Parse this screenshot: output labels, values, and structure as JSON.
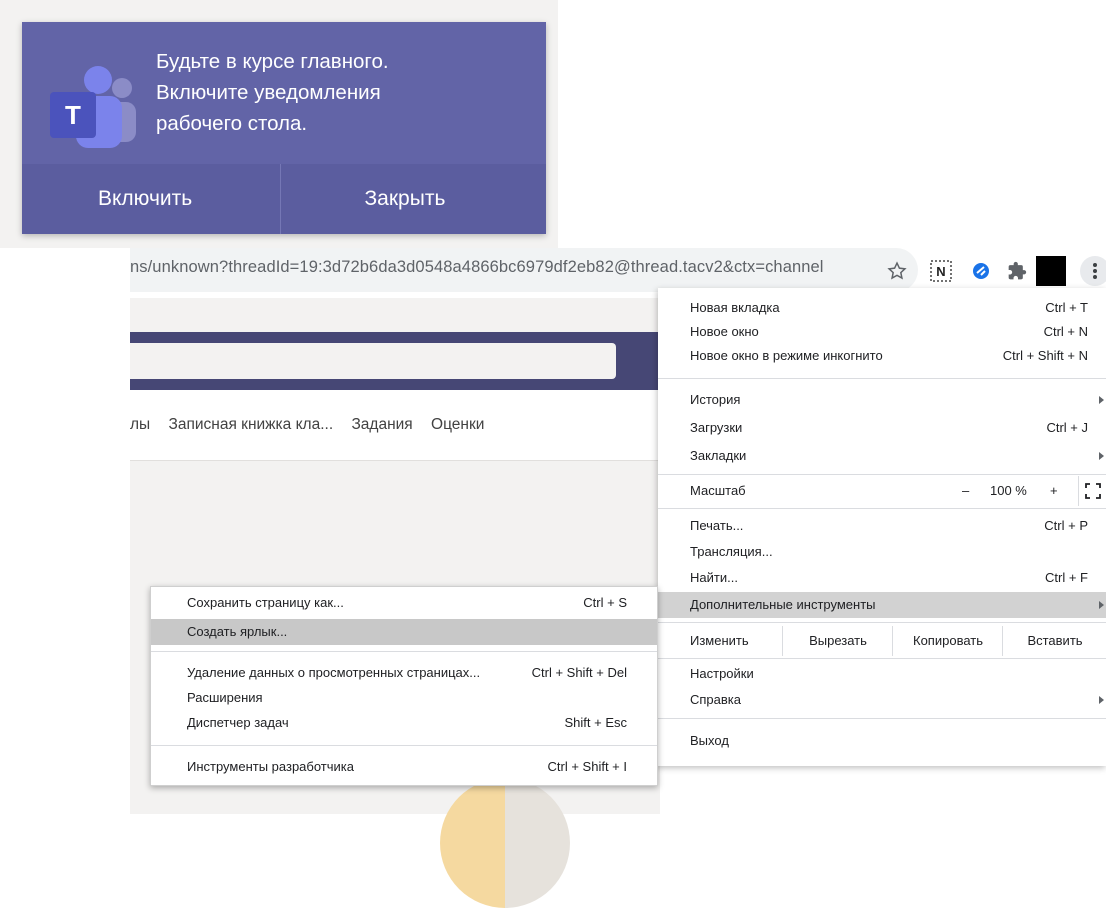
{
  "notification": {
    "lines": [
      "Будьте в курсе главного.",
      "Включите уведомления",
      "рабочего стола."
    ],
    "enable_label": "Включить",
    "close_label": "Закрыть",
    "colors": {
      "toast": "#6264a7",
      "actions": "#5b5d9f"
    }
  },
  "browser": {
    "url": "ns/unknown?threadId=19:3d72b6da3d0548a4866bc6979df2eb82@thread.tacv2&ctx=channel",
    "toolbar_icons": [
      "star-icon",
      "onenote-extension-icon",
      "extension-icon",
      "puzzle-icon",
      "profile-avatar",
      "more-menu-icon"
    ]
  },
  "page": {
    "tabs": [
      "лы",
      "Записная книжка кла...",
      "Задания",
      "Оценки"
    ],
    "colors": {
      "header": "#464775"
    }
  },
  "menu": {
    "new_tab": {
      "label": "Новая вкладка",
      "shortcut": "Ctrl + T"
    },
    "new_window": {
      "label": "Новое окно",
      "shortcut": "Ctrl + N"
    },
    "incognito": {
      "label": "Новое окно в режиме инкогнито",
      "shortcut": "Ctrl + Shift + N"
    },
    "history": {
      "label": "История"
    },
    "downloads": {
      "label": "Загрузки",
      "shortcut": "Ctrl + J"
    },
    "bookmarks": {
      "label": "Закладки"
    },
    "zoom": {
      "label": "Масштаб",
      "minus": "–",
      "value": "100 %",
      "plus": "+"
    },
    "print": {
      "label": "Печать...",
      "shortcut": "Ctrl + P"
    },
    "cast": {
      "label": "Трансляция..."
    },
    "find": {
      "label": "Найти...",
      "shortcut": "Ctrl + F"
    },
    "more_tools": {
      "label": "Дополнительные инструменты"
    },
    "edit": {
      "label": "Изменить",
      "cut": "Вырезать",
      "copy": "Копировать",
      "paste": "Вставить"
    },
    "settings": {
      "label": "Настройки"
    },
    "help": {
      "label": "Справка"
    },
    "exit": {
      "label": "Выход"
    }
  },
  "submenu": {
    "save_page": {
      "label": "Сохранить страницу как...",
      "shortcut": "Ctrl + S"
    },
    "create_shortcut": {
      "label": "Создать ярлык..."
    },
    "clear_data": {
      "label": "Удаление данных о просмотренных страницах...",
      "shortcut": "Ctrl + Shift + Del"
    },
    "extensions": {
      "label": "Расширения"
    },
    "task_manager": {
      "label": "Диспетчер задач",
      "shortcut": "Shift + Esc"
    },
    "dev_tools": {
      "label": "Инструменты разработчика",
      "shortcut": "Ctrl + Shift + I"
    }
  }
}
